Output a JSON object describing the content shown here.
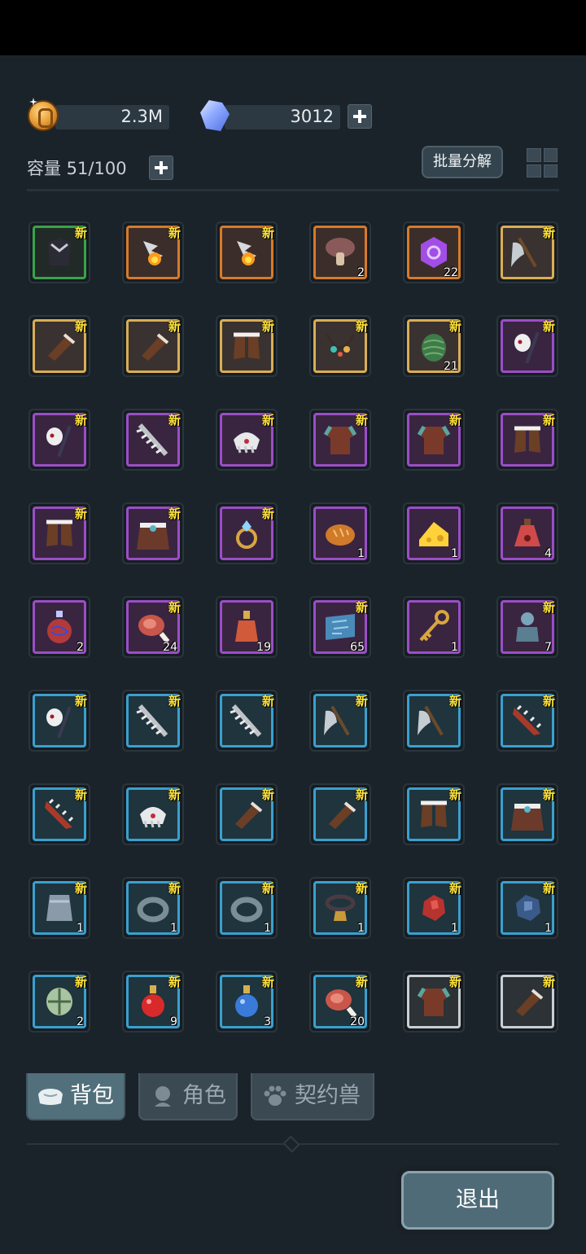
{
  "currency": {
    "gold_value": "2.3M",
    "gem_value": "3012",
    "gold_icon": "gold-coin-icon",
    "gem_icon": "blue-crystal-icon"
  },
  "inventory": {
    "capacity_label": "容量 51/100",
    "bulk_decompose_label": "批量分解",
    "new_tag": "新",
    "items": [
      {
        "name": "chest-armor",
        "rarity": "green",
        "new": true,
        "qty": ""
      },
      {
        "name": "horn-shard",
        "rarity": "orange",
        "new": true,
        "qty": ""
      },
      {
        "name": "horn-shard",
        "rarity": "orange",
        "new": true,
        "qty": ""
      },
      {
        "name": "mushroom",
        "rarity": "orange",
        "new": false,
        "qty": "2"
      },
      {
        "name": "purple-rune",
        "rarity": "orange",
        "new": false,
        "qty": "22"
      },
      {
        "name": "battle-axe",
        "rarity": "gold",
        "new": true,
        "qty": ""
      },
      {
        "name": "bracer",
        "rarity": "gold",
        "new": true,
        "qty": ""
      },
      {
        "name": "bracer",
        "rarity": "gold",
        "new": true,
        "qty": ""
      },
      {
        "name": "fur-boots",
        "rarity": "gold",
        "new": true,
        "qty": ""
      },
      {
        "name": "tooth-necklace",
        "rarity": "gold",
        "new": true,
        "qty": ""
      },
      {
        "name": "green-cocoon",
        "rarity": "gold",
        "new": true,
        "qty": "21"
      },
      {
        "name": "skull-staff",
        "rarity": "purple",
        "new": true,
        "qty": ""
      },
      {
        "name": "skull-staff",
        "rarity": "purple",
        "new": true,
        "qty": ""
      },
      {
        "name": "spine-blade",
        "rarity": "purple",
        "new": true,
        "qty": ""
      },
      {
        "name": "fang-helmet",
        "rarity": "purple",
        "new": true,
        "qty": ""
      },
      {
        "name": "leather-tunic",
        "rarity": "purple",
        "new": true,
        "qty": ""
      },
      {
        "name": "leather-tunic",
        "rarity": "purple",
        "new": true,
        "qty": ""
      },
      {
        "name": "fur-boots",
        "rarity": "purple",
        "new": true,
        "qty": ""
      },
      {
        "name": "fur-boots",
        "rarity": "purple",
        "new": true,
        "qty": ""
      },
      {
        "name": "fur-cloak",
        "rarity": "purple",
        "new": true,
        "qty": ""
      },
      {
        "name": "gem-ring",
        "rarity": "purple",
        "new": true,
        "qty": ""
      },
      {
        "name": "bread",
        "rarity": "purple",
        "new": false,
        "qty": "1"
      },
      {
        "name": "cheese",
        "rarity": "purple",
        "new": false,
        "qty": "1"
      },
      {
        "name": "paw-potion",
        "rarity": "purple",
        "new": false,
        "qty": "4"
      },
      {
        "name": "ornate-potion",
        "rarity": "purple",
        "new": false,
        "qty": "2"
      },
      {
        "name": "meat",
        "rarity": "purple",
        "new": true,
        "qty": "24"
      },
      {
        "name": "fire-potion",
        "rarity": "purple",
        "new": false,
        "qty": "19"
      },
      {
        "name": "blue-map",
        "rarity": "purple",
        "new": true,
        "qty": "65"
      },
      {
        "name": "golden-key",
        "rarity": "purple",
        "new": false,
        "qty": "1"
      },
      {
        "name": "statue",
        "rarity": "purple",
        "new": true,
        "qty": "7"
      },
      {
        "name": "skull-staff",
        "rarity": "blue",
        "new": true,
        "qty": ""
      },
      {
        "name": "spine-blade",
        "rarity": "blue",
        "new": true,
        "qty": ""
      },
      {
        "name": "spine-blade",
        "rarity": "blue",
        "new": true,
        "qty": ""
      },
      {
        "name": "battle-axe",
        "rarity": "blue",
        "new": true,
        "qty": ""
      },
      {
        "name": "battle-axe",
        "rarity": "blue",
        "new": true,
        "qty": ""
      },
      {
        "name": "serrated-blade",
        "rarity": "blue",
        "new": true,
        "qty": ""
      },
      {
        "name": "serrated-blade",
        "rarity": "blue",
        "new": true,
        "qty": ""
      },
      {
        "name": "fang-helmet",
        "rarity": "blue",
        "new": true,
        "qty": ""
      },
      {
        "name": "bracer",
        "rarity": "blue",
        "new": true,
        "qty": ""
      },
      {
        "name": "bracer",
        "rarity": "blue",
        "new": true,
        "qty": ""
      },
      {
        "name": "fur-boots",
        "rarity": "blue",
        "new": true,
        "qty": ""
      },
      {
        "name": "fur-cloak",
        "rarity": "blue",
        "new": true,
        "qty": ""
      },
      {
        "name": "stone-vase",
        "rarity": "blue",
        "new": true,
        "qty": "1"
      },
      {
        "name": "iron-ring",
        "rarity": "blue",
        "new": true,
        "qty": "1"
      },
      {
        "name": "iron-ring",
        "rarity": "blue",
        "new": true,
        "qty": "1"
      },
      {
        "name": "bell-collar",
        "rarity": "blue",
        "new": true,
        "qty": "1"
      },
      {
        "name": "red-ore",
        "rarity": "blue",
        "new": true,
        "qty": "1"
      },
      {
        "name": "blue-ore",
        "rarity": "blue",
        "new": true,
        "qty": "1"
      },
      {
        "name": "green-shell",
        "rarity": "blue",
        "new": true,
        "qty": "2"
      },
      {
        "name": "red-potion",
        "rarity": "blue",
        "new": true,
        "qty": "9"
      },
      {
        "name": "blue-potion",
        "rarity": "blue",
        "new": true,
        "qty": "3"
      },
      {
        "name": "meat",
        "rarity": "blue",
        "new": true,
        "qty": "20"
      },
      {
        "name": "leather-tunic",
        "rarity": "white",
        "new": true,
        "qty": ""
      },
      {
        "name": "bracer",
        "rarity": "white",
        "new": true,
        "qty": ""
      }
    ]
  },
  "tabs": [
    {
      "label": "背包",
      "icon": "bag-icon",
      "active": true
    },
    {
      "label": "角色",
      "icon": "character-icon",
      "active": false
    },
    {
      "label": "契约兽",
      "icon": "paw-icon",
      "active": false
    }
  ],
  "exit_label": "退出",
  "colors": {
    "new_tag": "#ffe33a",
    "rarity_green": "#3aa34a",
    "rarity_orange": "#d87a2a",
    "rarity_gold": "#d9ae55",
    "rarity_purple": "#9a4ec7",
    "rarity_blue": "#3aa0cf",
    "rarity_white": "#c9d0d4"
  }
}
